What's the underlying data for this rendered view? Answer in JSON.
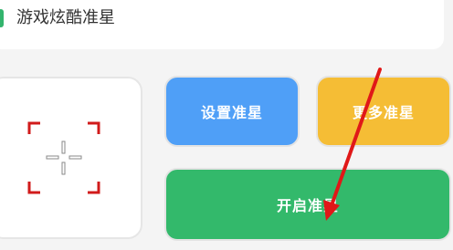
{
  "header": {
    "title": "游戏炫酷准星"
  },
  "buttons": {
    "set_crosshair": "设置准星",
    "more_crosshair": "更多准星",
    "enable_crosshair": "开启准星"
  },
  "colors": {
    "accent_green": "#33b46d",
    "button_blue": "#4f9ff7",
    "button_yellow": "#f5bd35",
    "button_green": "#33b96b",
    "crosshair_red": "#d11b1b",
    "annotation_arrow": "#e01818"
  },
  "icons": {
    "preview": "crosshair-icon",
    "annotation": "red-arrow-annotation"
  }
}
